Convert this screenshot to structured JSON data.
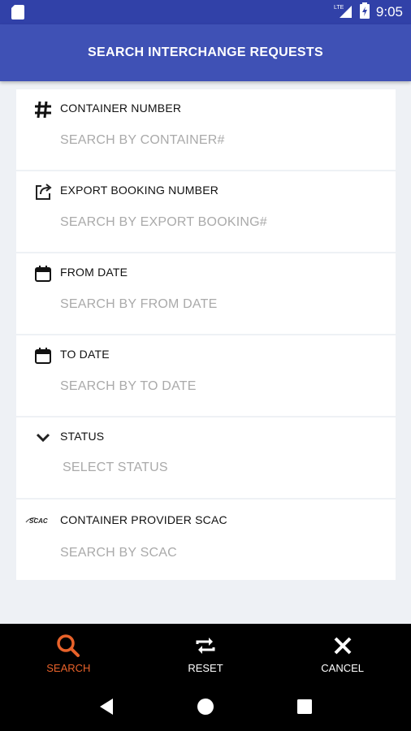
{
  "status_bar": {
    "time": "9:05",
    "network": "LTE"
  },
  "app_bar": {
    "title": "SEARCH INTERCHANGE REQUESTS"
  },
  "fields": {
    "container": {
      "label": "CONTAINER NUMBER",
      "placeholder": "SEARCH BY CONTAINER#",
      "icon": "hash-icon"
    },
    "export_booking": {
      "label": "EXPORT BOOKING NUMBER",
      "placeholder": "SEARCH BY EXPORT BOOKING#",
      "icon": "share-export-icon"
    },
    "from_date": {
      "label": "FROM DATE",
      "placeholder": "SEARCH BY FROM DATE",
      "icon": "calendar-icon"
    },
    "to_date": {
      "label": "TO DATE",
      "placeholder": "SEARCH BY TO DATE",
      "icon": "calendar-icon"
    },
    "status": {
      "label": "STATUS",
      "placeholder": "SELECT STATUS",
      "icon": "chevron-down-icon"
    },
    "scac": {
      "label": "CONTAINER PROVIDER SCAC",
      "placeholder": "SEARCH BY SCAC",
      "icon": "scac-logo-icon",
      "logo_text": "SCAC"
    }
  },
  "bottom_nav": {
    "search": "SEARCH",
    "reset": "RESET",
    "cancel": "CANCEL"
  },
  "colors": {
    "status_bar": "#3141a8",
    "app_bar": "#3f51b5",
    "accent": "#e8622a",
    "placeholder": "#aaaaaa",
    "background": "#eef1f5"
  }
}
